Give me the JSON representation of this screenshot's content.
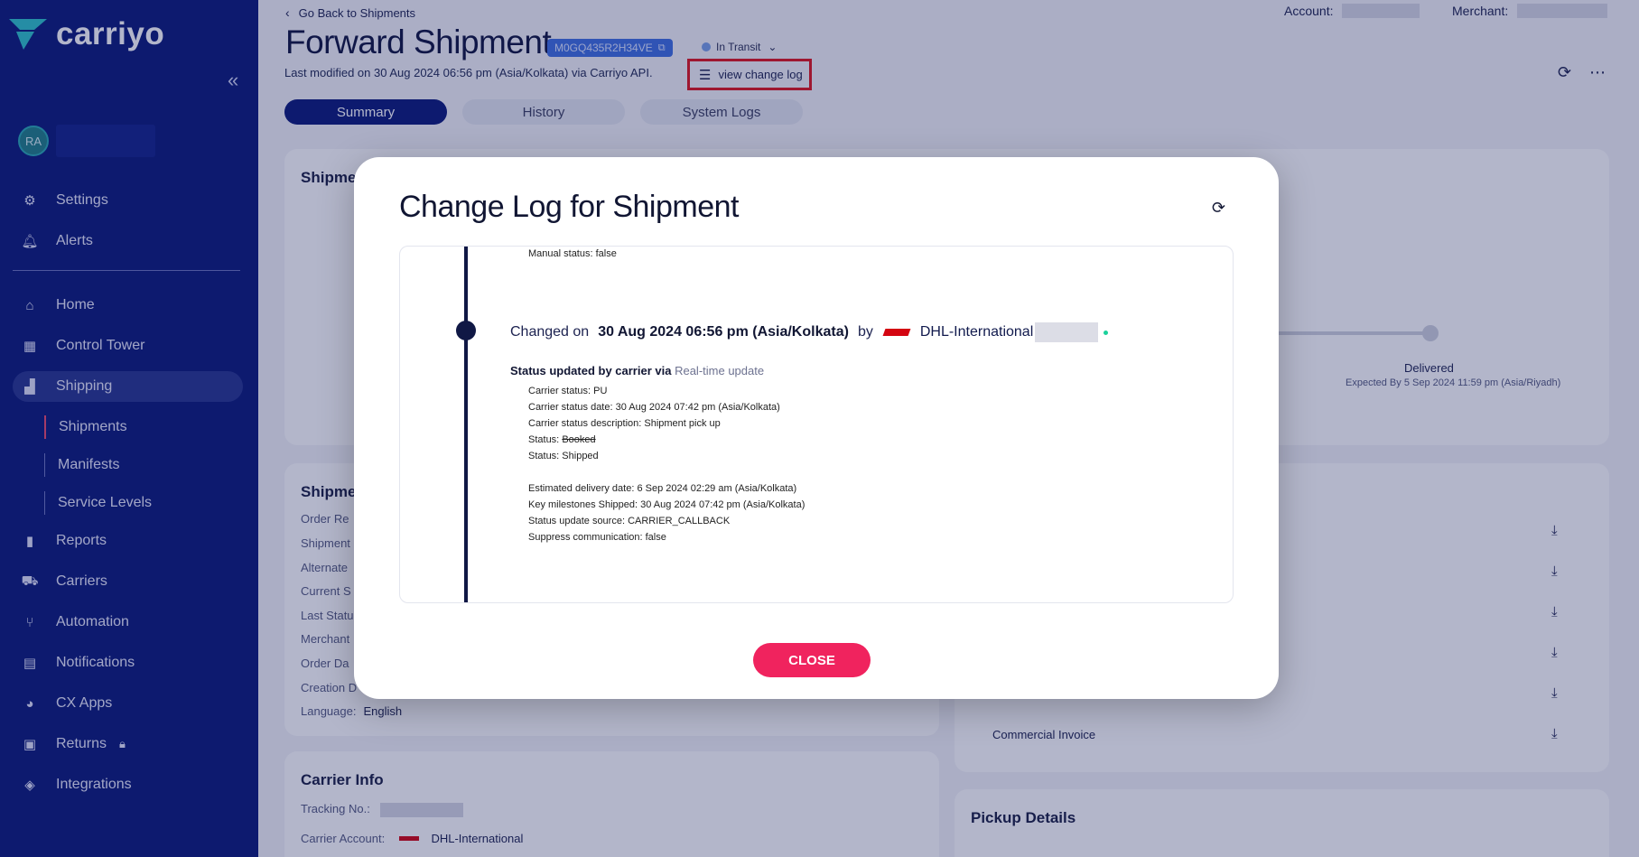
{
  "sidebar": {
    "brand": "carriyo",
    "user_initials": "RA",
    "items": [
      {
        "label": "Settings",
        "icon": "gear-icon"
      },
      {
        "label": "Alerts",
        "icon": "bell-icon"
      },
      {
        "label": "Home",
        "icon": "home-icon"
      },
      {
        "label": "Control Tower",
        "icon": "dashboard-icon"
      },
      {
        "label": "Shipping",
        "icon": "boxes-icon"
      },
      {
        "label": "Reports",
        "icon": "bar-chart-icon"
      },
      {
        "label": "Carriers",
        "icon": "truck-icon"
      },
      {
        "label": "Automation",
        "icon": "automation-icon"
      },
      {
        "label": "Notifications",
        "icon": "message-icon"
      },
      {
        "label": "CX Apps",
        "icon": "palette-icon"
      },
      {
        "label": "Returns",
        "icon": "returns-icon"
      },
      {
        "label": "Integrations",
        "icon": "layers-icon"
      }
    ],
    "sub_items": [
      "Shipments",
      "Manifests",
      "Service Levels"
    ]
  },
  "header": {
    "back": "Go Back to Shipments",
    "account_label": "Account:",
    "merchant_label": "Merchant:",
    "title": "Forward Shipment",
    "awb": "M0GQ435R2H34VE",
    "status": "In Transit",
    "modified": "Last modified on 30 Aug 2024 06:56 pm (Asia/Kolkata) via Carriyo API.",
    "change_log": "view change log"
  },
  "tabs": [
    "Summary",
    "History",
    "System Logs"
  ],
  "background": {
    "card1_title": "Shipme",
    "delivered_label": "Delivered",
    "delivered_expected": "Expected By 5 Sep 2024 11:59 pm (Asia/Riyadh)",
    "card2_title": "Shipme",
    "card2_rows": [
      "Order Re",
      "Shipment",
      "Alternate",
      "Current S",
      "Last Statu",
      "Merchant",
      "Order Da",
      "Creation D"
    ],
    "language_label": "Language:",
    "language_value": "English",
    "carrier_info_title": "Carrier Info",
    "tracking_label": "Tracking No.:",
    "carrier_account_label": "Carrier Account:",
    "carrier_account_value": "DHL-International",
    "commercial_invoice": "Commercial Invoice",
    "pickup_title": "Pickup Details"
  },
  "modal": {
    "title": "Change Log for Shipment",
    "manual_status": "Manual status: false",
    "changed_on_label": "Changed on",
    "changed_on_value": "30 Aug 2024 06:56 pm (Asia/Kolkata)",
    "by_label": "by",
    "carrier": "DHL-International",
    "update_head": "Status updated by carrier via",
    "update_source": "Real-time update",
    "lines": [
      "Carrier status: PU",
      "Carrier status date: 30 Aug 2024 07:42 pm (Asia/Kolkata)",
      "Carrier status description: Shipment pick up"
    ],
    "status_old_label": "Status:",
    "status_old_value": "Booked",
    "status_new": "Status: Shipped",
    "lines2": [
      "Estimated delivery date: 6 Sep 2024 02:29 am (Asia/Kolkata)",
      "Key milestones Shipped: 30 Aug 2024 07:42 pm (Asia/Kolkata)",
      "Status update source: CARRIER_CALLBACK",
      "Suppress communication: false"
    ],
    "close": "CLOSE"
  }
}
